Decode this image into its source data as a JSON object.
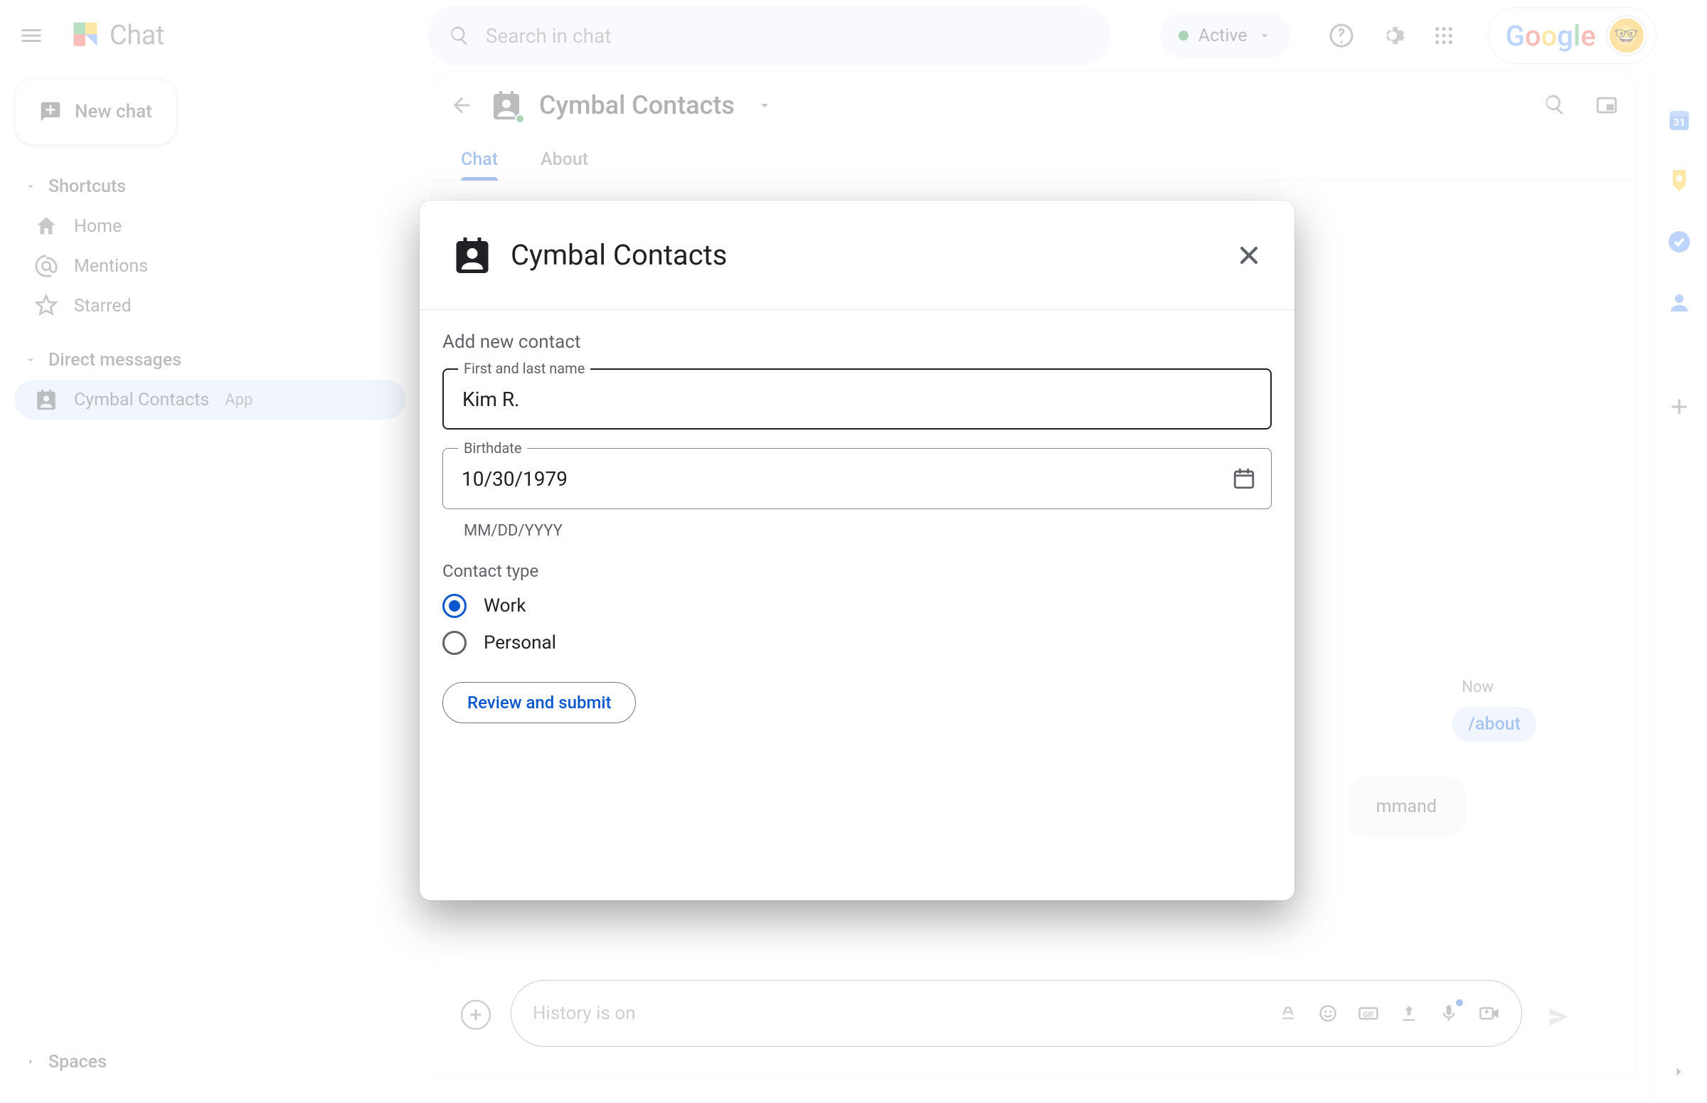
{
  "topbar": {
    "search_placeholder": "Search in chat",
    "status_label": "Active",
    "google_label": "Google",
    "avatar_emoji": "🤓"
  },
  "sidebar": {
    "new_chat_label": "New chat",
    "sections": {
      "shortcuts_label": "Shortcuts",
      "dm_label": "Direct messages",
      "spaces_label": "Spaces"
    },
    "shortcut_items": [
      {
        "label": "Home"
      },
      {
        "label": "Mentions"
      },
      {
        "label": "Starred"
      }
    ],
    "dm_items": [
      {
        "label": "Cymbal Contacts",
        "chip": "App"
      }
    ]
  },
  "chat": {
    "title": "Cymbal Contacts",
    "tabs": [
      {
        "label": "Chat",
        "active": true
      },
      {
        "label": "About",
        "active": false
      }
    ],
    "msg_time": "Now",
    "msg_command": "/about",
    "bot_msg_tail": "mmand",
    "compose_placeholder": "History is on"
  },
  "dialog": {
    "title": "Cymbal Contacts",
    "subtitle": "Add new contact",
    "name_label": "First and last name",
    "name_value": "Kim R.",
    "birth_label": "Birthdate",
    "birth_value": "10/30/1979",
    "birth_helper": "MM/DD/YYYY",
    "contact_type_label": "Contact type",
    "radio_work": "Work",
    "radio_personal": "Personal",
    "submit_label": "Review and submit"
  },
  "logo_text": "Chat"
}
